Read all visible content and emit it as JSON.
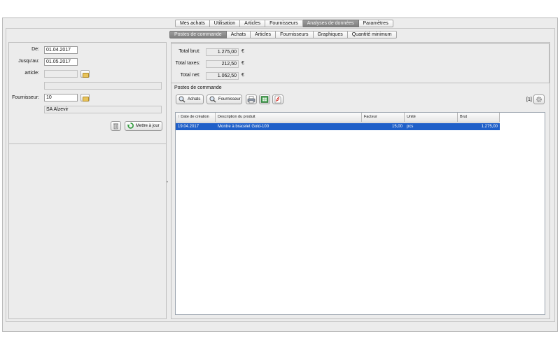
{
  "main_tabs": [
    {
      "label": "Mes achats",
      "selected": false
    },
    {
      "label": "Utilisation",
      "selected": false
    },
    {
      "label": "Articles",
      "selected": false
    },
    {
      "label": "Fournisseurs",
      "selected": false
    },
    {
      "label": "Analyses de données",
      "selected": true
    },
    {
      "label": "Paramètres",
      "selected": false
    }
  ],
  "sub_tabs": [
    {
      "label": "Postes de commande",
      "selected": true
    },
    {
      "label": "Achats",
      "selected": false
    },
    {
      "label": "Articles",
      "selected": false
    },
    {
      "label": "Fournisseurs",
      "selected": false
    },
    {
      "label": "Graphiques",
      "selected": false
    },
    {
      "label": "Quantité minimum",
      "selected": false
    }
  ],
  "filters": {
    "from_label": "De:",
    "from_value": "01.04.2017",
    "to_label": "Jusqu'au:",
    "to_value": "01.05.2017",
    "article_label": "article:",
    "article_value": "",
    "article_name": "",
    "supplier_label": "Fournisseur:",
    "supplier_value": "10",
    "supplier_name": "SA Alzevir",
    "update_button": "Mettre à jour"
  },
  "totals": {
    "gross_label": "Total brut:",
    "gross_value": "1.275,00",
    "tax_label": "Total taxes:",
    "tax_value": "212,50",
    "net_label": "Total net:",
    "net_value": "1.062,50",
    "currency": "€"
  },
  "order_lines": {
    "title": "Postes de commande",
    "purchases_button": "Achats",
    "supplier_button": "Fournisseur",
    "page_count": "[1]",
    "columns": [
      "↑ Date de création",
      "Description du produit",
      "Facteur",
      "Unité",
      "Brut"
    ],
    "rows": [
      {
        "date": "19.04.2017",
        "description": "Montre à bracelet Gold-100",
        "factor": "15,00",
        "unit": "pcs",
        "gross": "1.275,00",
        "selected": true
      }
    ]
  },
  "colors": {
    "selected_row": "#1f5fc8",
    "selected_tab": "#8a8a8a",
    "window_bg": "#ececec"
  }
}
